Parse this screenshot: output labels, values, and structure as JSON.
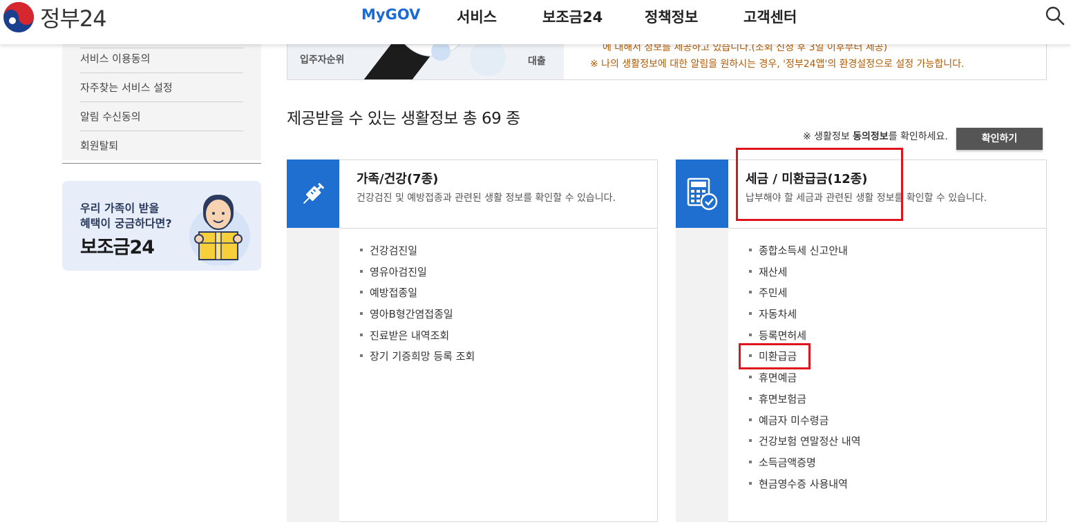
{
  "header": {
    "logo_text": "정부24",
    "nav": [
      {
        "label": "MyGOV",
        "active": true
      },
      {
        "label": "서비스",
        "active": false
      },
      {
        "label": "보조금24",
        "active": false
      },
      {
        "label": "정책정보",
        "active": false
      },
      {
        "label": "고객센터",
        "active": false
      }
    ],
    "search_icon": "search-icon"
  },
  "sidebar": {
    "items": [
      "서비스 이용동의",
      "자주찾는 서비스 설정",
      "알림 수신동의",
      "회원탈퇴"
    ]
  },
  "banner": {
    "line1": "우리 가족이 받을",
    "line2": "혜택이 궁금하다면?",
    "brand": "보조금24"
  },
  "info_box": {
    "illust_label1": "입주자순위",
    "illust_label2": "대출",
    "clipped_text": "에 대해서 정보를 제공하고 있습니다.(조회 신청 후 3일 이후부터 제공)",
    "note": "※ 나의 생활정보에 대한 알림을 원하시는 경우, '정부24앱'의 환경설정으로 설정 가능합니다."
  },
  "section": {
    "title": "제공받을 수 있는 생활정보 총 69 종",
    "consent_prefix": "※ 생활정보 ",
    "consent_bold": "동의정보",
    "consent_suffix": "를 확인하세요.",
    "confirm_label": "확인하기"
  },
  "cards": [
    {
      "icon": "syringe-icon",
      "title": "가족/건강(7종)",
      "desc": "건강검진 및 예방접종과 관련된 생활 정보를 확인할 수 있습니다.",
      "items": [
        "건강검진일",
        "영유아검진일",
        "예방접종일",
        "영아B형간염접종일",
        "진료받은 내역조회",
        "장기 기증희망 등록 조회"
      ]
    },
    {
      "icon": "calculator-check-icon",
      "title": "세금 / 미환급금(12종)",
      "desc": "납부해야 할 세금과 관련된 생활 정보를 확인할 수 있습니다.",
      "items": [
        "종합소득세 신고안내",
        "재산세",
        "주민세",
        "자동차세",
        "등록면허세",
        "미환급금",
        "휴면예금",
        "휴면보험금",
        "예금자 미수령금",
        "건강보험 연말정산 내역",
        "소득금액증명",
        "현금영수증 사용내역"
      ]
    }
  ],
  "colors": {
    "brand_blue": "#1f6fd0",
    "nav_active": "#1b6bd6",
    "notice_orange": "#b35a00",
    "highlight_red": "#e0121b"
  }
}
